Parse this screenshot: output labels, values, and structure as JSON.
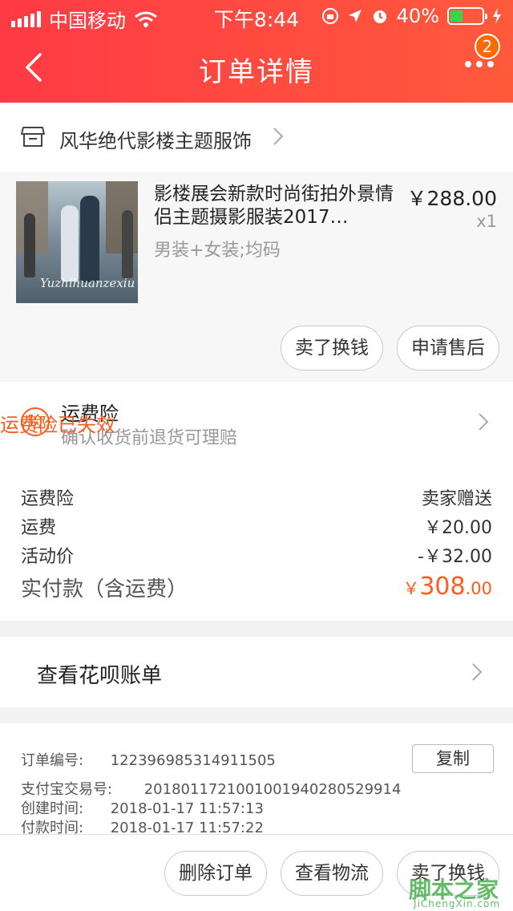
{
  "status_bar": {
    "carrier": "中国移动",
    "time": "下午8:44",
    "battery": "40%",
    "battery_level": 0.4
  },
  "nav": {
    "title": "订单详情",
    "badge": "2"
  },
  "shop": {
    "name": "风华绝代影楼主题服饰"
  },
  "product": {
    "title": "影楼展会新款时尚街拍外景情侣主题摄影服装2017…",
    "spec": "男装+女装;均码",
    "price": "￥288.00",
    "quantity": "x1",
    "image_signature": "Yuzhihuanzexiu",
    "actions": [
      "卖了换钱",
      "申请售后"
    ]
  },
  "insurance": {
    "title": "运费险",
    "subtitle": "确认收货前退货可理赔",
    "status": "运费险已失效",
    "icon_label": "险"
  },
  "summary": {
    "rows": [
      {
        "label": "运费险",
        "value": "卖家赠送"
      },
      {
        "label": "运费",
        "value": "￥20.00"
      },
      {
        "label": "活动价",
        "value": "-￥32.00"
      }
    ],
    "total_label": "实付款（含运费）",
    "total_currency": "￥",
    "total_int": "308",
    "total_dec": ".00"
  },
  "huabei": {
    "label": "查看花呗账单"
  },
  "order_info": {
    "order_no_label": "订单编号:",
    "order_no": "122396985314911505",
    "copy_label": "复制",
    "alipay_label": "支付宝交易号:",
    "alipay_no": "2018011721001001940280529914",
    "created_label": "创建时间:",
    "created": "2018-01-17 11:57:13",
    "paid_label": "付款时间:",
    "paid": "2018-01-17 11:57:22"
  },
  "bottom_actions": [
    "删除订单",
    "查看物流",
    "卖了换钱"
  ],
  "watermark": {
    "logo": "脚本之家",
    "site": "JiChengXin.com"
  },
  "colors": {
    "header_start": "#ff3a45",
    "header_end": "#ff5a3c",
    "accent_orange": "#ff5a1f",
    "badge": "#ff6a00"
  }
}
